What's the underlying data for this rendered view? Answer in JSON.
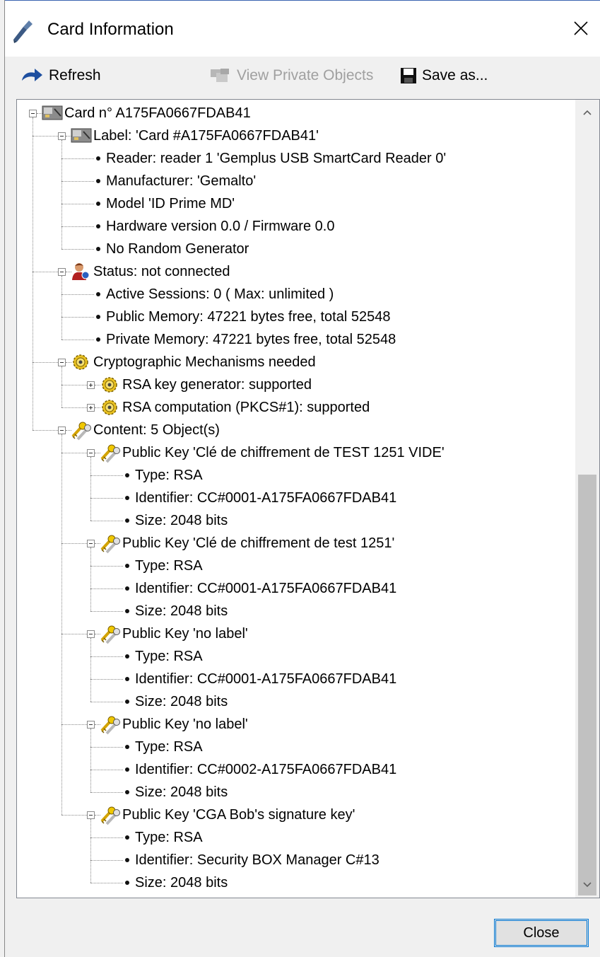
{
  "window": {
    "title": "Card Information",
    "close_tooltip": "Close"
  },
  "toolbar": {
    "refresh": "Refresh",
    "view_private": "View Private Objects",
    "save_as": "Save as..."
  },
  "tree": [
    {
      "label": "Card n° A175FA0667FDAB41"
    },
    {
      "label": "Label: 'Card #A175FA0667FDAB41'"
    },
    {
      "label": "Reader: reader 1  'Gemplus USB SmartCard Reader 0'"
    },
    {
      "label": "Manufacturer: 'Gemalto'"
    },
    {
      "label": "Model 'ID Prime MD'"
    },
    {
      "label": "Hardware version 0.0 / Firmware 0.0"
    },
    {
      "label": "No Random Generator"
    },
    {
      "label": "Status: not connected"
    },
    {
      "label": "Active Sessions: 0  ( Max:  unlimited )"
    },
    {
      "label": "Public Memory: 47221 bytes free, total 52548"
    },
    {
      "label": "Private Memory: 47221 bytes free, total 52548"
    },
    {
      "label": "Cryptographic Mechanisms needed"
    },
    {
      "label": "RSA key generator: supported"
    },
    {
      "label": "RSA computation (PKCS#1): supported"
    },
    {
      "label": "Content:  5 Object(s)"
    },
    {
      "label": "Public Key 'Clé de chiffrement de TEST 1251 VIDE'"
    },
    {
      "label": "Type: RSA"
    },
    {
      "label": "Identifier: CC#0001-A175FA0667FDAB41"
    },
    {
      "label": "Size: 2048 bits"
    },
    {
      "label": "Public Key 'Clé de chiffrement de test 1251'"
    },
    {
      "label": "Type: RSA"
    },
    {
      "label": "Identifier: CC#0001-A175FA0667FDAB41"
    },
    {
      "label": "Size: 2048 bits"
    },
    {
      "label": "Public Key 'no label'"
    },
    {
      "label": "Type: RSA"
    },
    {
      "label": "Identifier: CC#0001-A175FA0667FDAB41"
    },
    {
      "label": "Size: 2048 bits"
    },
    {
      "label": "Public Key 'no label'"
    },
    {
      "label": "Type: RSA"
    },
    {
      "label": "Identifier: CC#0002-A175FA0667FDAB41"
    },
    {
      "label": "Size: 2048 bits"
    },
    {
      "label": "Public Key 'CGA Bob's signature key'"
    },
    {
      "label": "Type: RSA"
    },
    {
      "label": "Identifier: Security BOX Manager C#13"
    },
    {
      "label": "Size: 2048 bits"
    }
  ],
  "footer": {
    "close": "Close"
  },
  "colors": {
    "accent": "#0078d7",
    "disabled_text": "#a0a0a0"
  }
}
